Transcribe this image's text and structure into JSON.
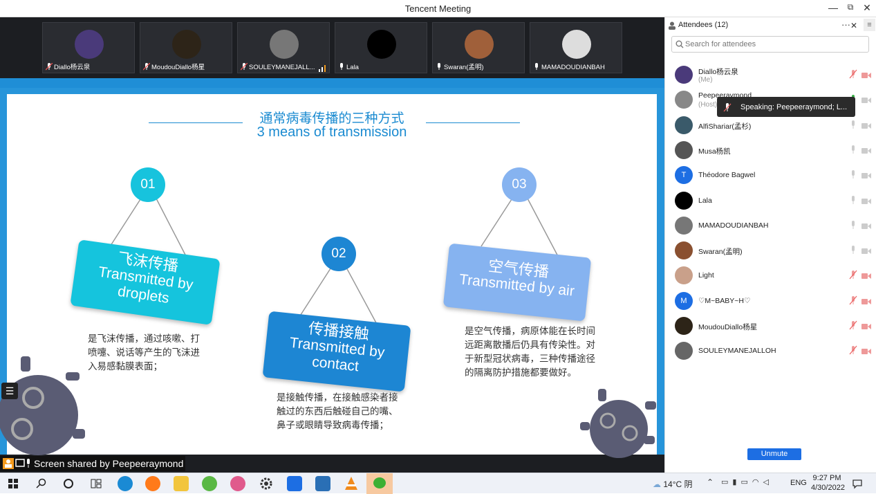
{
  "window": {
    "title": "Tencent Meeting",
    "minimize": "—",
    "restore": "⧉",
    "close": "✕"
  },
  "tiles": [
    {
      "name": "Diallo杨云泉",
      "color": "#4a3a7a",
      "muted": true
    },
    {
      "name": "MoudouDiallo杨星",
      "color": "#2d2418",
      "muted": true
    },
    {
      "name": "SOULEYMANEJALL...",
      "color": "#777",
      "muted": true
    },
    {
      "name": "Lala",
      "color": "#000",
      "muted": false
    },
    {
      "name": "Swaran(孟明)",
      "color": "#a0603a",
      "muted": false
    },
    {
      "name": "MAMADOUDIANBAH",
      "color": "#ddd",
      "muted": false
    }
  ],
  "slide": {
    "title_cn": "通常病毒传播的三种方式",
    "title_en": "3 means of transmission",
    "items": [
      {
        "num": "01",
        "cn": "飞沫传播",
        "en": "Transmitted by droplets",
        "desc": [
          "是飞沫传播，通过咳嗽、打",
          "喷嚏、说话等产生的飞沫进",
          "入易感黏膜表面；"
        ]
      },
      {
        "num": "02",
        "cn": "传播接触",
        "en": "Transmitted by contact",
        "desc": [
          "是接触传播，在接触感染者接",
          "触过的东西后触碰自己的嘴、",
          "鼻子或眼睛导致病毒传播；"
        ]
      },
      {
        "num": "03",
        "cn": "空气传播",
        "en": "Transmitted by air",
        "desc": [
          "是空气传播，病原体能在长时间",
          "远距离散播后仍具有传染性。对",
          "于新型冠状病毒，三种传播途径",
          "的隔离防护措施都要做好。"
        ]
      }
    ]
  },
  "share_status": "Screen shared by Peepeeraymond",
  "sidebar": {
    "title": "Attendees (12)",
    "more": "···",
    "close": "✕",
    "search_placeholder": "Search for attendees",
    "unmute": "Unmute",
    "tooltip": "Speaking: Peepeeraymond; L...",
    "attendees": [
      {
        "name": "Diallo杨云泉",
        "sub": "(Me)",
        "initial": "",
        "color": "#4a3a7a",
        "mic": "muted"
      },
      {
        "name": "Peepeeraymond",
        "sub": "(Host)",
        "initial": "",
        "color": "#888",
        "mic": "on"
      },
      {
        "name": "AlfiShariar(孟杉)",
        "sub": "",
        "initial": "",
        "color": "#3a5a6a",
        "mic": "off"
      },
      {
        "name": "Musa杨凯",
        "sub": "",
        "initial": "",
        "color": "#555",
        "mic": "off"
      },
      {
        "name": "Théodore Bagwel",
        "sub": "",
        "initial": "T",
        "color": "#1d6ee3",
        "mic": "off"
      },
      {
        "name": "Lala",
        "sub": "",
        "initial": "",
        "color": "#000",
        "mic": "off"
      },
      {
        "name": "MAMADOUDIANBAH",
        "sub": "",
        "initial": "",
        "color": "#777",
        "mic": "off"
      },
      {
        "name": "Swaran(孟明)",
        "sub": "",
        "initial": "",
        "color": "#8a5030",
        "mic": "off"
      },
      {
        "name": "Light",
        "sub": "",
        "initial": "",
        "color": "#c9a08a",
        "mic": "muted"
      },
      {
        "name": "♡M~BABY~H♡",
        "sub": "",
        "initial": "M",
        "color": "#1d6ee3",
        "mic": "muted"
      },
      {
        "name": "MoudouDiallo杨星",
        "sub": "",
        "initial": "",
        "color": "#2d2418",
        "mic": "muted"
      },
      {
        "name": "SOULEYMANEJALLOH",
        "sub": "",
        "initial": "",
        "color": "#666",
        "mic": "muted"
      }
    ]
  },
  "taskbar": {
    "weather": "14°C 阴",
    "lang": "ENG",
    "time": "9:27 PM",
    "date": "4/30/2022"
  }
}
